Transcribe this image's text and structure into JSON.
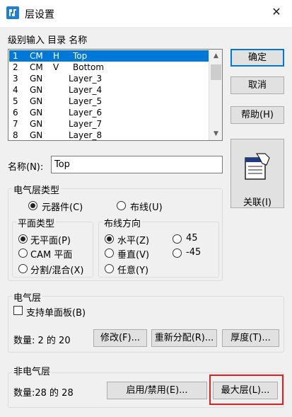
{
  "window": {
    "title": "层设置",
    "close_glyph": "✕",
    "app_icon": "layer-app-icon"
  },
  "list": {
    "header": "级别输入  目录  名称",
    "rows": [
      {
        "num": "1",
        "type": "CM",
        "dir": "H",
        "name": "Top",
        "selected": true
      },
      {
        "num": "2",
        "type": "CM",
        "dir": "V",
        "name": "Bottom"
      },
      {
        "num": "3",
        "type": "GN",
        "dir": "",
        "name": "Layer_3"
      },
      {
        "num": "4",
        "type": "GN",
        "dir": "",
        "name": "Layer_4"
      },
      {
        "num": "5",
        "type": "GN",
        "dir": "",
        "name": "Layer_5"
      },
      {
        "num": "6",
        "type": "GN",
        "dir": "",
        "name": "Layer_6"
      },
      {
        "num": "7",
        "type": "GN",
        "dir": "",
        "name": "Layer_7"
      },
      {
        "num": "8",
        "type": "GN",
        "dir": "",
        "name": "Layer_8"
      }
    ],
    "scroll_up": "▲",
    "scroll_down": "▼"
  },
  "buttons": {
    "ok": "确定",
    "cancel": "取消",
    "help": "帮助(H)",
    "associate": "关联(I)",
    "modify": "修改(F)...",
    "reassign": "重新分配(R)...",
    "thickness": "厚度(T)...",
    "enable_disable": "启用/禁用(E)...",
    "max_layers": "最大层(L)..."
  },
  "name_field": {
    "label": "名称(N):",
    "value": "Top"
  },
  "electrical_type": {
    "title": "电气层类型",
    "component": "元器件(C)",
    "routing": "布线(U)",
    "plane_type": {
      "title": "平面类型",
      "none": "无平面(P)",
      "cam": "CAM 平面",
      "split": "分割/混合(X)"
    },
    "routing_dir": {
      "title": "布线方向",
      "horizontal": "水平(Z)",
      "vertical": "垂直(V)",
      "any": "任意(Y)",
      "d45": "45",
      "dm45": "-45"
    }
  },
  "electrical_layers": {
    "title": "电气层",
    "single_side": "支持单面板(B)",
    "count": "数量: 2 的 20"
  },
  "non_electrical_layers": {
    "title": "非电气层",
    "count": "数量:28 的 28"
  }
}
